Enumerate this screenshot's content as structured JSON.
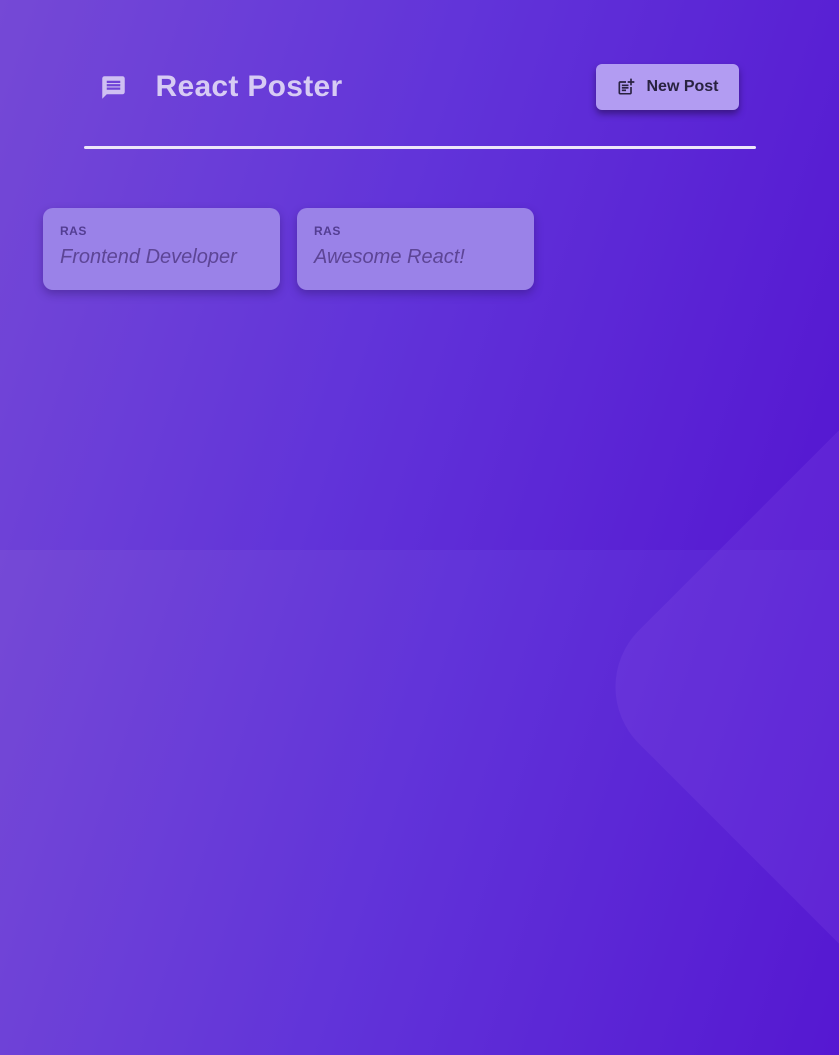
{
  "header": {
    "title": "React Poster",
    "new_post_label": "New Post"
  },
  "posts": [
    {
      "author": "RAS",
      "body": "Frontend Developer"
    },
    {
      "author": "RAS",
      "body": "Awesome React!"
    }
  ],
  "icons": {
    "logo": "chat-bubble-icon",
    "new_post": "post-add-icon"
  },
  "colors": {
    "background_gradient_start": "#7549d6",
    "background_gradient_end": "#5517d1",
    "title_text": "#d7cbf4",
    "divider": "#ece6f8",
    "button_background": "#b29cf2",
    "button_text": "#292240",
    "card_background": "#9a82e8",
    "post_author_text": "#533d92",
    "post_body_text": "#5d4596"
  }
}
